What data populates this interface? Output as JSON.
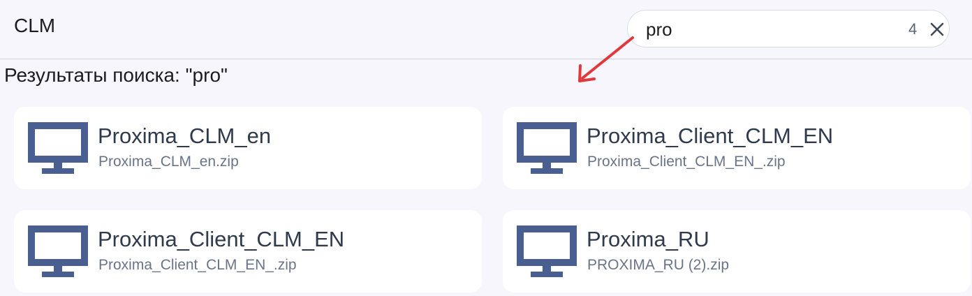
{
  "header": {
    "title": "CLM"
  },
  "search": {
    "value": "pro",
    "result_count": "4",
    "clear_icon": "close-icon"
  },
  "results": {
    "heading": "Результаты поиска: \"pro\"",
    "items": [
      {
        "title": "Proxima_CLM_en",
        "filename": "Proxima_CLM_en.zip",
        "icon": "monitor-icon"
      },
      {
        "title": "Proxima_Client_CLM_EN",
        "filename": "Proxima_Client_CLM_EN_.zip",
        "icon": "monitor-icon"
      },
      {
        "title": "Proxima_Client_CLM_EN",
        "filename": "Proxima_Client_CLM_EN_.zip",
        "icon": "monitor-icon"
      },
      {
        "title": "Proxima_RU",
        "filename": "PROXIMA_RU (2).zip",
        "icon": "monitor-icon"
      }
    ]
  },
  "colors": {
    "background": "#f8f6fd",
    "card": "#ffffff",
    "icon": "#4a5f91",
    "annotation_arrow": "#e0393b"
  }
}
